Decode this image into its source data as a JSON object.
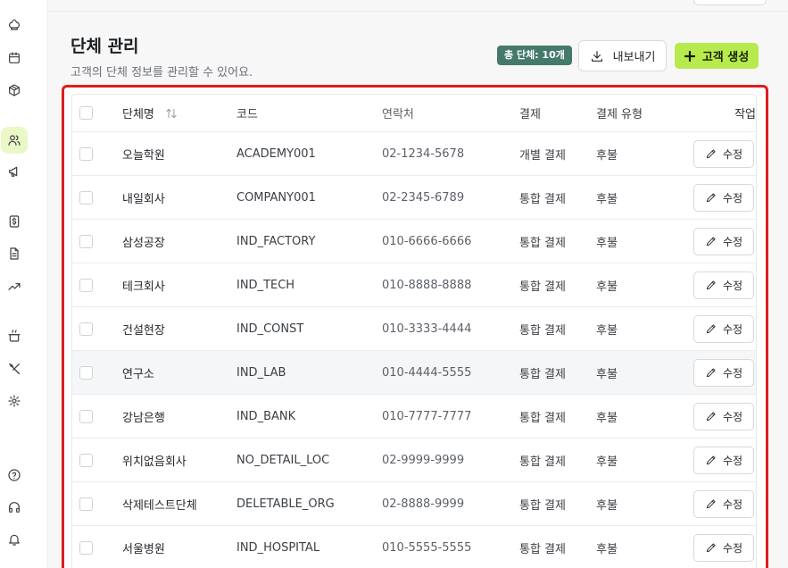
{
  "sidebar": {
    "items": [
      {
        "icon": "chef-hat-icon",
        "active": false
      },
      {
        "icon": "calendar-icon",
        "active": false
      },
      {
        "icon": "package-icon",
        "active": false
      },
      {
        "icon": "users-icon",
        "active": true
      },
      {
        "icon": "megaphone-icon",
        "active": false
      },
      {
        "icon": "dollar-icon",
        "active": false
      },
      {
        "icon": "document-icon",
        "active": false
      },
      {
        "icon": "trending-up-icon",
        "active": false
      },
      {
        "icon": "cooking-pot-icon",
        "active": false
      },
      {
        "icon": "utensils-crossed-icon",
        "active": false
      },
      {
        "icon": "settings-icon",
        "active": false
      },
      {
        "icon": "help-circle-icon",
        "active": false
      },
      {
        "icon": "headphones-icon",
        "active": false
      },
      {
        "icon": "bell-icon",
        "active": false
      }
    ]
  },
  "header": {
    "title": "단체 관리",
    "subtitle": "고객의 단체 정보를 관리할 수 있어요.",
    "total_badge": "총 단체: 10개",
    "export_label": "내보내기",
    "create_label": "고객 생성"
  },
  "table": {
    "columns": {
      "name": "단체명",
      "code": "코드",
      "contact": "연락처",
      "payment": "결제",
      "payment_type": "결제 유형",
      "action": "작업"
    },
    "edit_label": "수정",
    "rows": [
      {
        "name": "오늘학원",
        "code": "ACADEMY001",
        "contact": "02-1234-5678",
        "payment": "개별 결제",
        "payment_type": "후불"
      },
      {
        "name": "내일회사",
        "code": "COMPANY001",
        "contact": "02-2345-6789",
        "payment": "통합 결제",
        "payment_type": "후불"
      },
      {
        "name": "삼성공장",
        "code": "IND_FACTORY",
        "contact": "010-6666-6666",
        "payment": "통합 결제",
        "payment_type": "후불"
      },
      {
        "name": "테크회사",
        "code": "IND_TECH",
        "contact": "010-8888-8888",
        "payment": "통합 결제",
        "payment_type": "후불"
      },
      {
        "name": "건설현장",
        "code": "IND_CONST",
        "contact": "010-3333-4444",
        "payment": "통합 결제",
        "payment_type": "후불"
      },
      {
        "name": "연구소",
        "code": "IND_LAB",
        "contact": "010-4444-5555",
        "payment": "통합 결제",
        "payment_type": "후불"
      },
      {
        "name": "강남은행",
        "code": "IND_BANK",
        "contact": "010-7777-7777",
        "payment": "통합 결제",
        "payment_type": "후불"
      },
      {
        "name": "위치없음회사",
        "code": "NO_DETAIL_LOC",
        "contact": "02-9999-9999",
        "payment": "통합 결제",
        "payment_type": "후불"
      },
      {
        "name": "삭제테스트단체",
        "code": "DELETABLE_ORG",
        "contact": "02-8888-9999",
        "payment": "통합 결제",
        "payment_type": "후불"
      },
      {
        "name": "서울병원",
        "code": "IND_HOSPITAL",
        "contact": "010-5555-5555",
        "payment": "통합 결제",
        "payment_type": "후불"
      }
    ]
  },
  "colors": {
    "accent": "#b7ea4c",
    "badge": "#45796c",
    "highlight_border": "#dc1e1e"
  }
}
